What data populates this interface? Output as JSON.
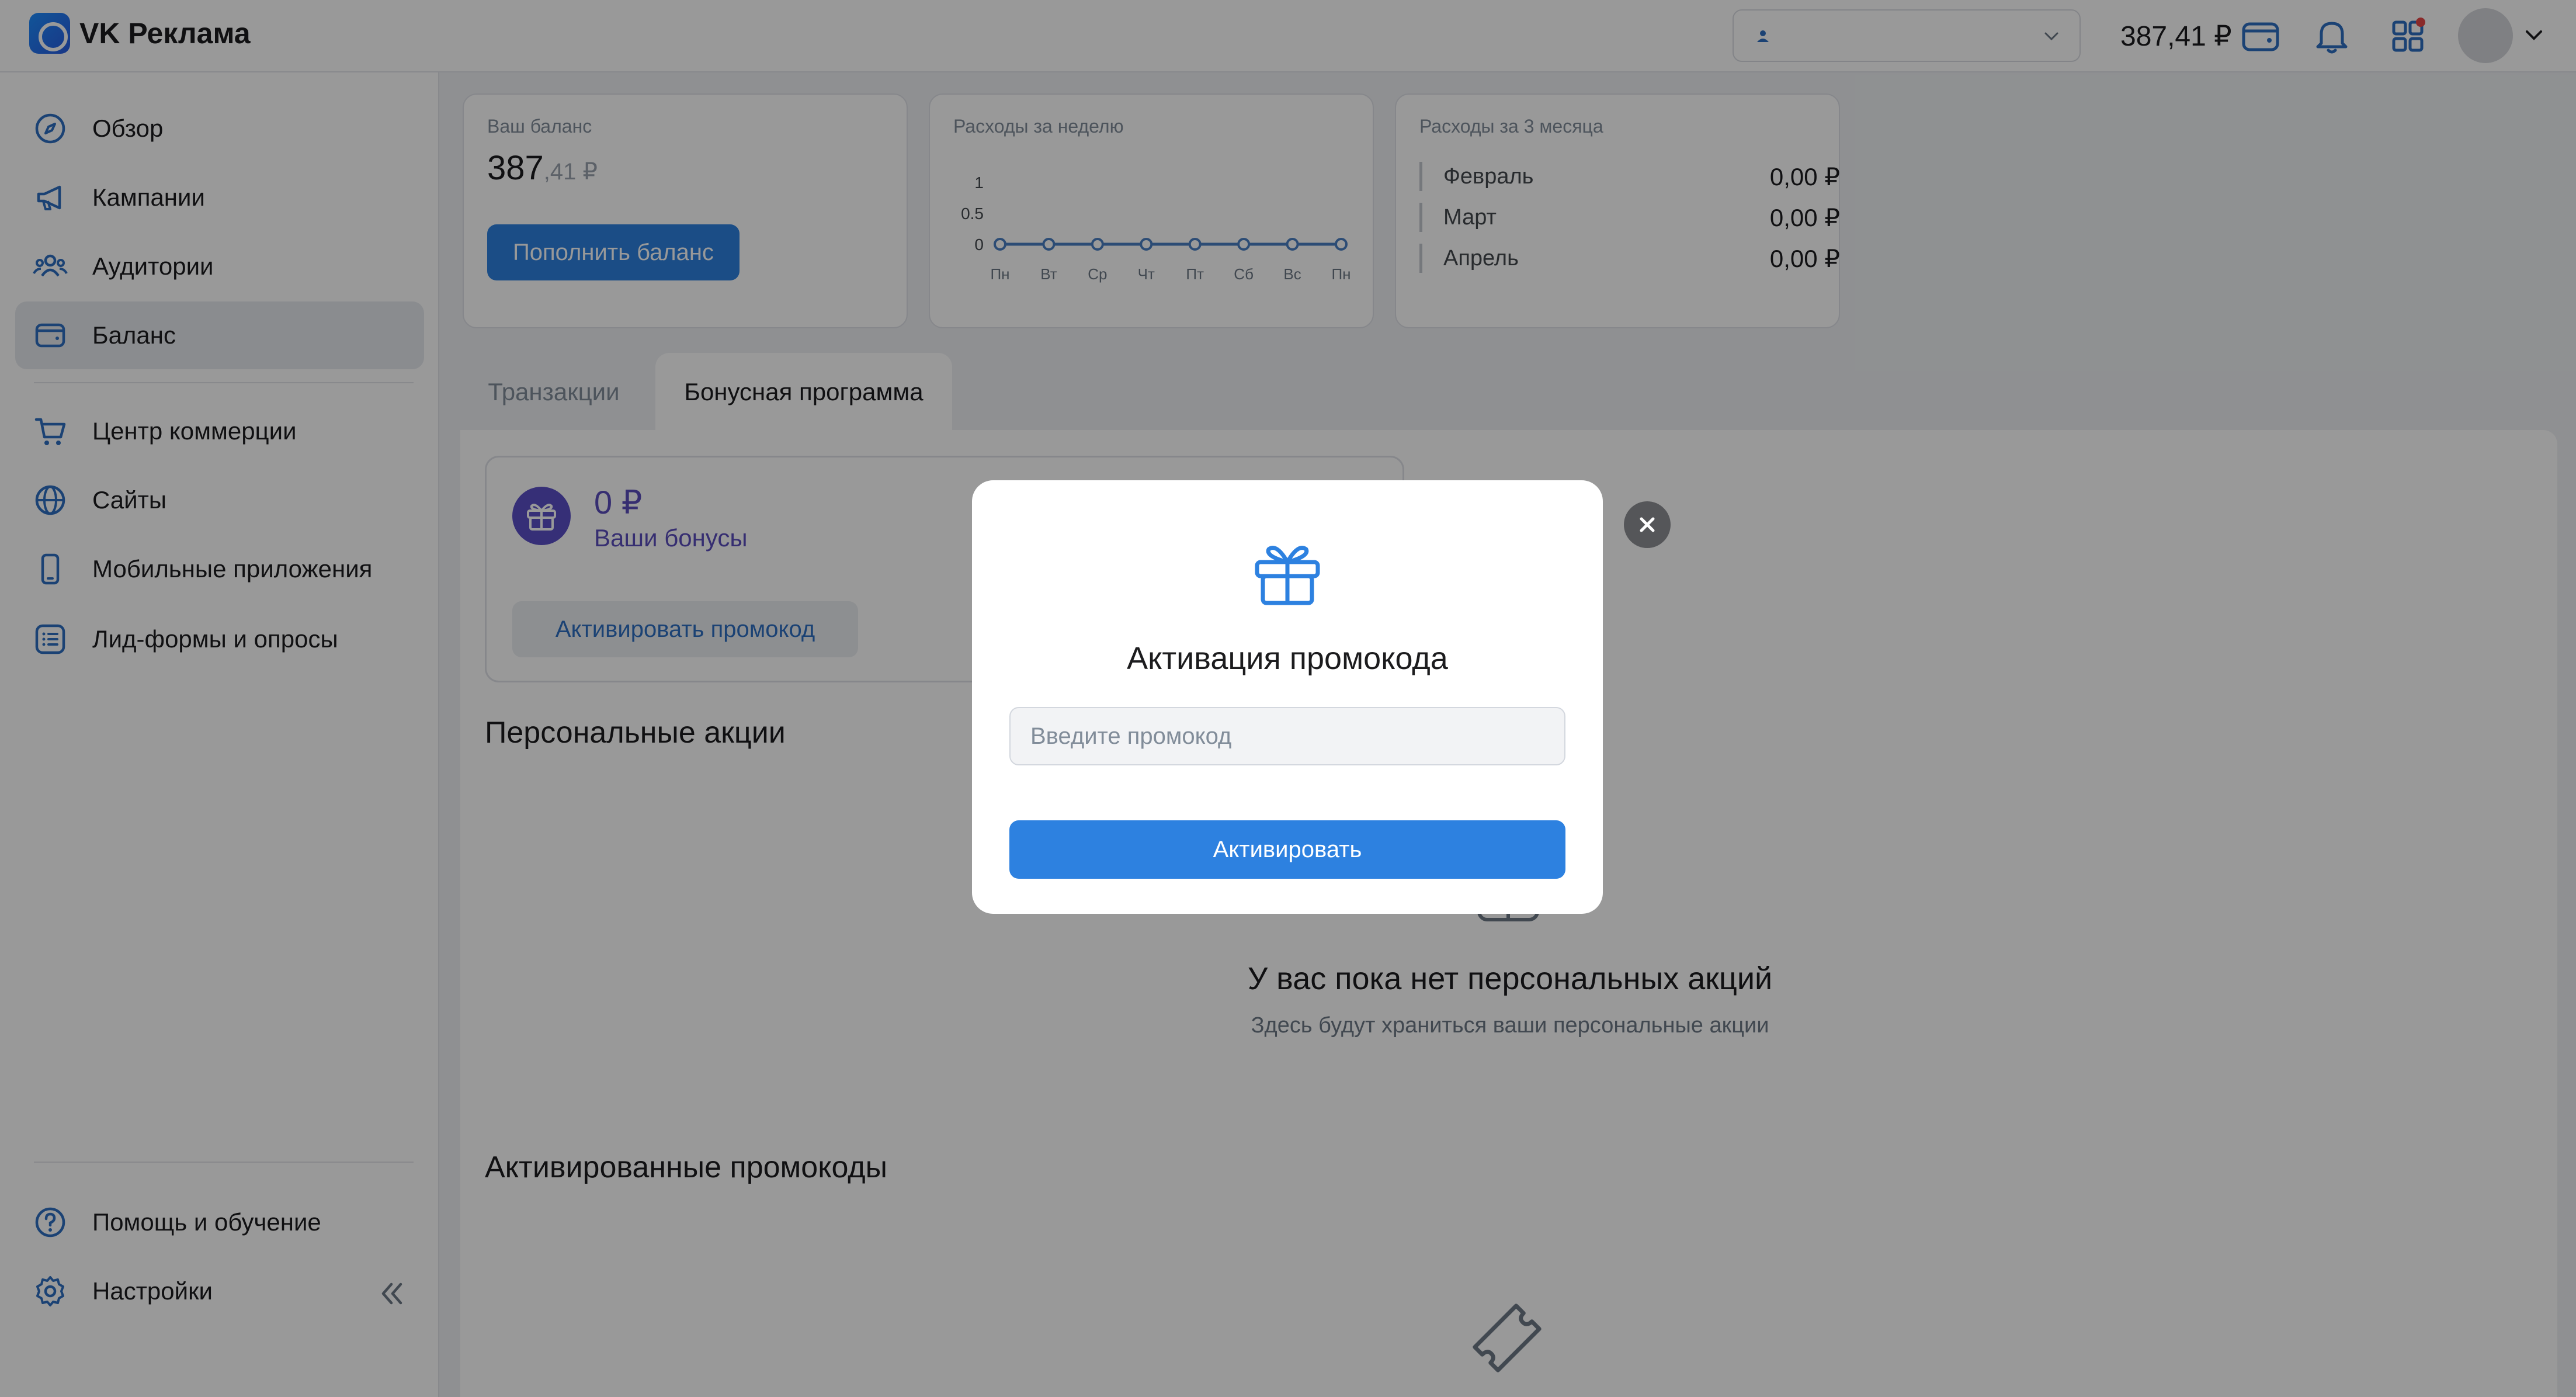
{
  "topbar": {
    "brand": "VK Реклама",
    "balance": "387,41 ₽"
  },
  "sidebar": {
    "items": [
      {
        "label": "Обзор",
        "icon": "compass-icon"
      },
      {
        "label": "Кампании",
        "icon": "megaphone-icon"
      },
      {
        "label": "Аудитории",
        "icon": "users-icon"
      },
      {
        "label": "Баланс",
        "icon": "wallet-icon",
        "active": true
      },
      {
        "label": "Центр коммерции",
        "icon": "cart-icon"
      },
      {
        "label": "Сайты",
        "icon": "globe-icon"
      },
      {
        "label": "Мобильные приложения",
        "icon": "smartphone-icon"
      },
      {
        "label": "Лид-формы и опросы",
        "icon": "list-icon"
      }
    ],
    "footer": [
      {
        "label": "Помощь и обучение",
        "icon": "help-icon"
      },
      {
        "label": "Настройки",
        "icon": "gear-icon"
      }
    ]
  },
  "balance_card": {
    "title": "Ваш баланс",
    "value_main": "387",
    "value_cents": ",41 ₽",
    "button": "Пополнить баланс"
  },
  "weekly_card": {
    "title": "Расходы за неделю"
  },
  "chart_data": {
    "type": "line",
    "categories": [
      "Пн",
      "Вт",
      "Ср",
      "Чт",
      "Пт",
      "Сб",
      "Вс",
      "Пн"
    ],
    "series": [
      {
        "values": [
          0,
          0,
          0,
          0,
          0,
          0,
          0,
          0
        ]
      }
    ],
    "y_ticks": [
      "1",
      "0.5",
      "0"
    ],
    "ylim": [
      0,
      1
    ],
    "grid": false,
    "color": "#4a7fc4"
  },
  "months_card": {
    "title": "Расходы за 3 месяца",
    "rows": [
      {
        "name": "Февраль",
        "value": "0,00 ₽"
      },
      {
        "name": "Март",
        "value": "0,00 ₽"
      },
      {
        "name": "Апрель",
        "value": "0,00 ₽"
      }
    ]
  },
  "tabs": [
    {
      "label": "Транзакции",
      "active": false
    },
    {
      "label": "Бонусная программа",
      "active": true
    }
  ],
  "bonus": {
    "amount": "0 ₽",
    "label": "Ваши бонусы",
    "activate_button": "Активировать промокод"
  },
  "sections": {
    "personal": "Персональные акции",
    "empty_title": "У вас пока нет персональных акций",
    "empty_sub": "Здесь будут храниться ваши персональные акции",
    "activated": "Активированные промокоды"
  },
  "modal": {
    "title": "Активация промокода",
    "input_placeholder": "Введите промокод",
    "input_value": "",
    "button": "Активировать"
  },
  "colors": {
    "accent": "#2d81e0",
    "bonus": "#5a4fc7",
    "overlay": "rgba(0,0,0,0.40)"
  }
}
